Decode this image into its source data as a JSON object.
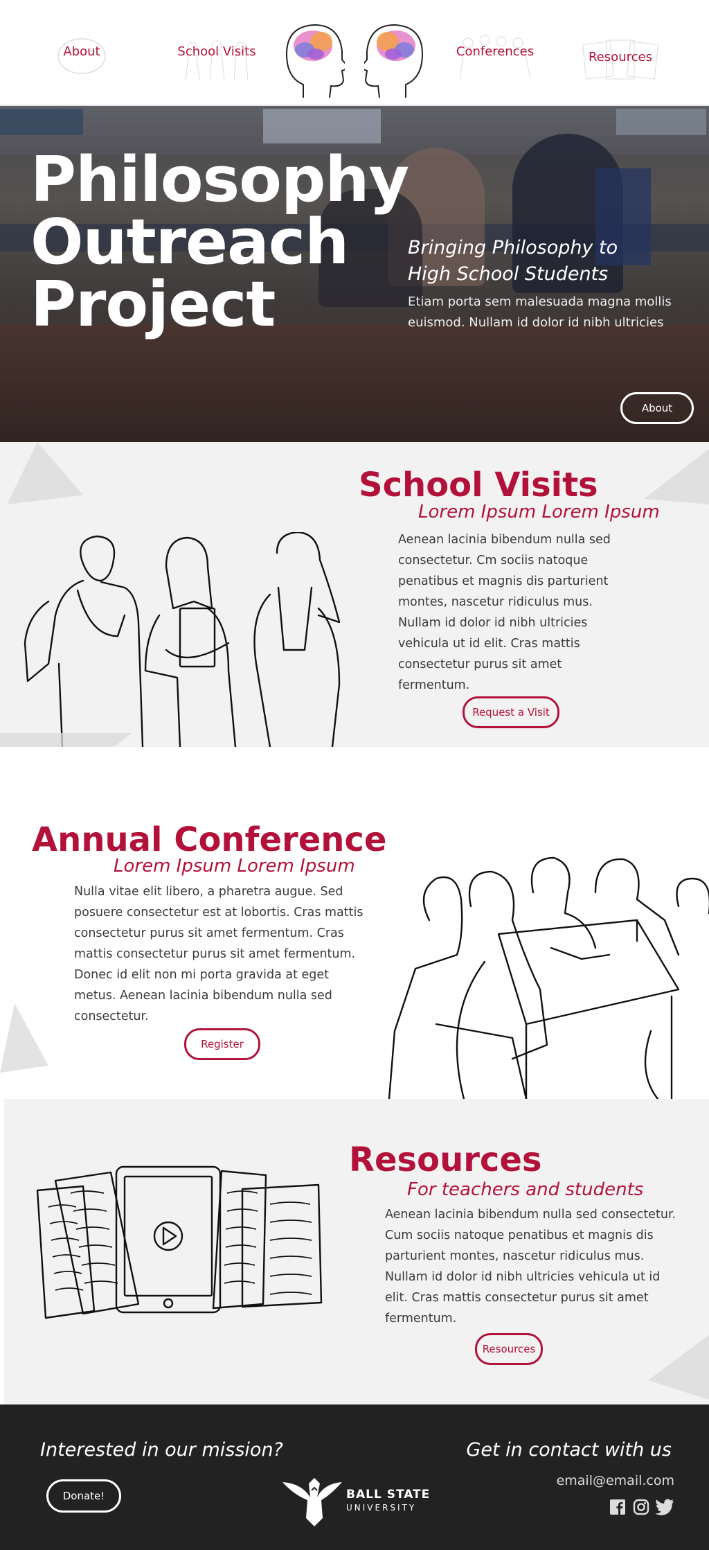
{
  "nav": {
    "links": [
      {
        "label": "About"
      },
      {
        "label": "School Visits"
      },
      {
        "label": "Conferences"
      },
      {
        "label": "Resources"
      }
    ]
  },
  "hero": {
    "title_lines": [
      "Philosophy",
      "Outreach",
      "Project"
    ],
    "subtitle_lines": [
      "Bringing Philosophy to",
      "High School Students"
    ],
    "description": "Etiam porta sem malesuada magna mollis euismod. Nullam id dolor id nibh ultricies",
    "button_label": "About"
  },
  "school_visits": {
    "title": "School Visits",
    "subtitle": "Lorem Ipsum Lorem Ipsum",
    "body": "Aenean lacinia bibendum nulla sed consectetur. Cm sociis natoque penatibus et magnis dis parturient montes, nascetur ridiculus mus. Nullam id dolor id nibh ultricies vehicula ut id elit. Cras mattis consectetur purus sit amet fermentum.",
    "button_label": "Request a Visit"
  },
  "conference": {
    "title": "Annual Conference",
    "subtitle": "Lorem Ipsum Lorem Ipsum",
    "body": "Nulla vitae elit libero, a pharetra augue. Sed posuere consectetur est at lobortis. Cras mattis consectetur purus sit amet fermentum. Cras mattis consectetur purus sit amet fermentum. Donec id elit non mi porta gravida at eget metus. Aenean lacinia bibendum nulla sed consectetur.",
    "button_label": "Register"
  },
  "resources": {
    "title": "Resources",
    "subtitle": "For teachers and students",
    "body": "Aenean lacinia bibendum nulla sed consectetur. Cum sociis natoque penatibus et magnis dis parturient montes, nascetur ridiculus mus. Nullam id dolor id nibh ultricies vehicula ut id elit. Cras mattis consectetur purus sit amet fermentum.",
    "button_label": "Resources"
  },
  "footer": {
    "left_heading": "Interested in our mission?",
    "donate_label": "Donate!",
    "logo_line1": "BALL STATE",
    "logo_line2": "UNIVERSITY",
    "right_heading": "Get in contact with us",
    "email": "email@email.com",
    "social_icons": [
      "facebook-icon",
      "instagram-icon",
      "twitter-icon"
    ]
  },
  "colors": {
    "accent": "#b2123a",
    "footer_bg": "#222222",
    "section_gray": "#f2f2f2"
  }
}
